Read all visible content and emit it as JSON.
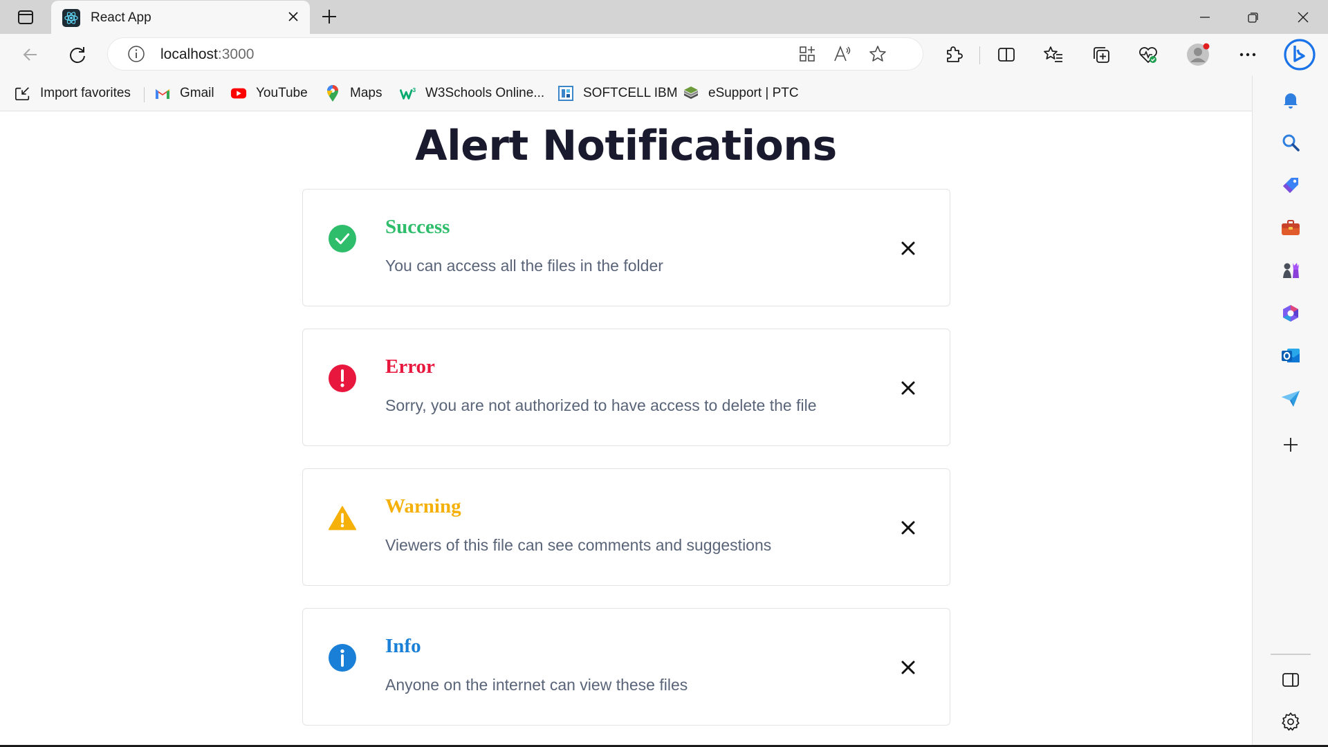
{
  "browser": {
    "tab": {
      "title": "React App"
    },
    "address": {
      "host": "localhost",
      "port": ":3000"
    },
    "favorites": [
      {
        "label": "Import favorites",
        "icon": "import-favorites-icon"
      },
      {
        "label": "Gmail",
        "icon": "gmail-icon"
      },
      {
        "label": "YouTube",
        "icon": "youtube-icon"
      },
      {
        "label": "Maps",
        "icon": "maps-pin-icon"
      },
      {
        "label": "W3Schools Online...",
        "icon": "w3schools-icon"
      },
      {
        "label": "SOFTCELL IBM",
        "icon": "softcell-icon"
      },
      {
        "label": "eSupport | PTC",
        "icon": "ptc-icon"
      }
    ]
  },
  "page": {
    "title": "Alert Notifications",
    "alerts": [
      {
        "type": "success",
        "title": "Success",
        "message": "You can access all the files in the folder",
        "color": "#2ebd6b",
        "icon": "check-circle-icon"
      },
      {
        "type": "error",
        "title": "Error",
        "message": "Sorry, you are not authorized to have access to delete the file",
        "color": "#e8173e",
        "icon": "exclamation-circle-icon"
      },
      {
        "type": "warning",
        "title": "Warning",
        "message": "Viewers of this file can see comments and suggestions",
        "color": "#f5b10a",
        "icon": "warning-triangle-icon"
      },
      {
        "type": "info",
        "title": "Info",
        "message": "Anyone on the internet can view these files",
        "color": "#1a7fd6",
        "icon": "info-circle-icon"
      }
    ]
  }
}
